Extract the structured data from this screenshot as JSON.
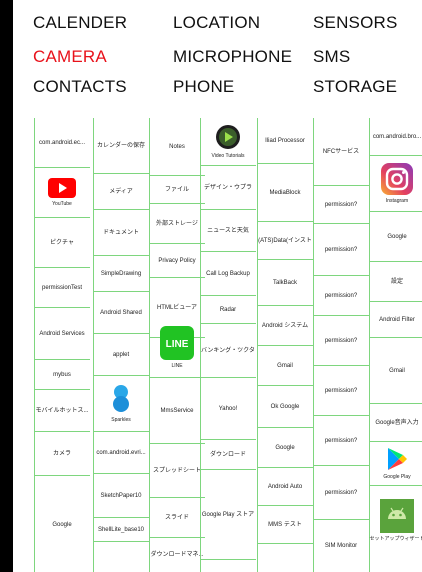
{
  "permissions": {
    "row1": [
      "CALENDER",
      "LOCATION",
      "SENSORS"
    ],
    "row2": [
      "CAMERA",
      "MICROPHONE",
      "SMS"
    ],
    "row3": [
      "CONTACTS",
      "PHONE",
      "STORAGE"
    ]
  },
  "active_permission": "CAMERA",
  "colors": {
    "active": "#e8121b",
    "divider": "#7ed67e"
  },
  "columns": [
    {
      "cells": [
        "com.android.ec...",
        "YouTube",
        "ピクチャ",
        "permissionTest",
        "Android Services",
        "mybus",
        "モバイルホットス...",
        "カメラ",
        "Google"
      ],
      "icon_names": [
        "youtube-icon"
      ]
    },
    {
      "cells": [
        "カレンダーの保存",
        "メディア",
        "ドキュメント",
        "SimpleDrawing",
        "Android Shared",
        "applet",
        "Sparkles",
        "com.android.evri...",
        "SketchPaper10",
        "ShellLite_base10"
      ],
      "icon_names": [
        "sparkles-icon"
      ]
    },
    {
      "cells": [
        "Notes",
        "ファイル",
        "外部ストレージ",
        "Privacy Policy",
        "HTMLビューア",
        "LINE",
        "MmsService",
        "スプレッドシート",
        "スライド",
        "ダウンロードマネ..."
      ],
      "icon_names": [
        "line-icon"
      ]
    },
    {
      "cells": [
        "Video Tutorials",
        "デザイン・ウプラ",
        "ニュースと天気",
        "Call Log Backup",
        "Radar",
        "バンキング・ツクタ",
        "Yahoo!",
        "ダウンロード",
        "Google Play ストア"
      ],
      "icon_names": [
        "video-play-icon"
      ]
    },
    {
      "cells": [
        "Iliad Processor",
        "MediaBlock",
        "(ATS)Data(インスト",
        "TalkBack",
        "Android システム",
        "Gmail",
        "Ok Google",
        "Google",
        "Android Auto",
        "MMS テスト"
      ],
      "icon_names": []
    },
    {
      "cells": [
        "NFCサービス",
        "permission?",
        "permission?",
        "permission?",
        "permission?",
        "permission?",
        "permission?",
        "permission?",
        "SIM Monitor"
      ],
      "icon_names": []
    },
    {
      "cells": [
        "com.android.bro...",
        "Instagram",
        "Google",
        "設定",
        "Android Filter",
        "Gmail",
        "Google音声入力",
        "Google Play",
        "セットアップウィザード"
      ],
      "icon_names": [
        "instagram-icon",
        "google-play-icon",
        "android-icon"
      ]
    }
  ]
}
